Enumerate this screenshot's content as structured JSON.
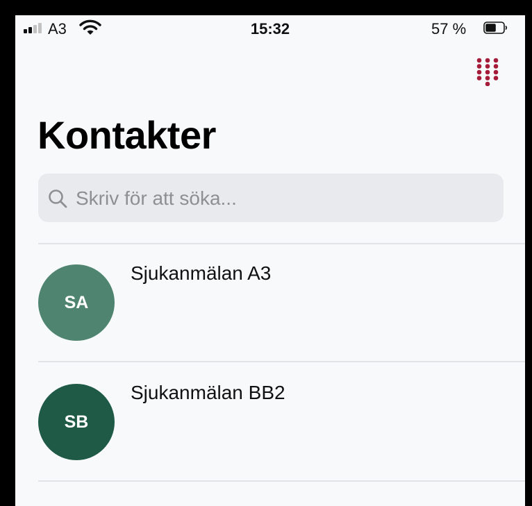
{
  "status_bar": {
    "carrier": "A3",
    "time": "15:32",
    "battery_percent": "57 %",
    "battery_level": 0.57,
    "signal_bars_active": 2,
    "signal_bars_total": 4
  },
  "header": {
    "keypad_icon": "keypad-icon",
    "title": "Kontakter"
  },
  "search": {
    "placeholder": "Skriv för att söka...",
    "value": ""
  },
  "contacts": [
    {
      "initials": "SA",
      "name": "Sjukanmälan A3",
      "avatar_color": "#4f8570"
    },
    {
      "initials": "SB",
      "name": "Sjukanmälan BB2",
      "avatar_color": "#1f5a47"
    }
  ],
  "colors": {
    "accent": "#a51c3b",
    "background": "#f8f9fb",
    "search_bg": "#e9eaee"
  }
}
